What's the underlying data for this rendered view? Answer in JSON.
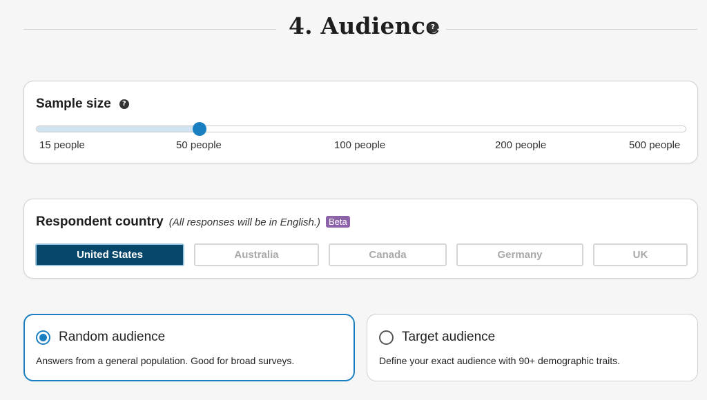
{
  "section": {
    "title": "4. Audience",
    "help_glyph": "?"
  },
  "sample_size": {
    "title": "Sample size",
    "help_glyph": "?",
    "ticks": [
      "15 people",
      "50 people",
      "100 people",
      "200 people",
      "500 people"
    ],
    "selected_index": 1,
    "selected_value": "50 people"
  },
  "country": {
    "title": "Respondent country",
    "note": "(All responses will be in English.)",
    "badge": "Beta",
    "options": [
      "United States",
      "Australia",
      "Canada",
      "Germany",
      "UK"
    ],
    "selected": "United States"
  },
  "audience": {
    "random": {
      "title": "Random audience",
      "description": "Answers from a general population. Good for broad surveys.",
      "selected": true
    },
    "target": {
      "title": "Target audience",
      "description": "Define your exact audience with 90+ demographic traits.",
      "selected": false
    }
  },
  "colors": {
    "accent": "#1a7fc1",
    "selected_button": "#06476b",
    "beta_badge": "#8c63a8",
    "slider_fill": "#cfe3f0"
  }
}
